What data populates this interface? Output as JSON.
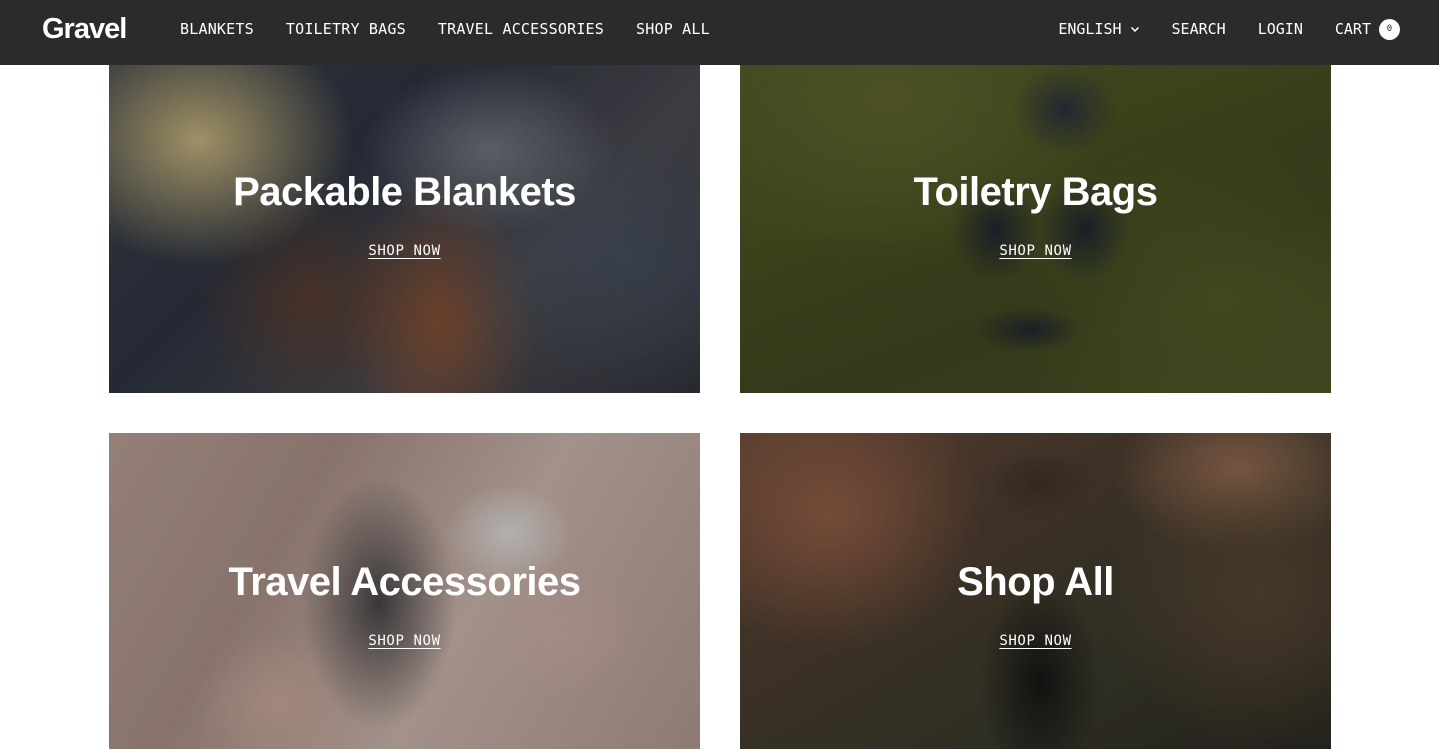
{
  "header": {
    "logo_text": "Gravel",
    "nav": [
      {
        "label": "BLANKETS"
      },
      {
        "label": "TOILETRY BAGS"
      },
      {
        "label": "TRAVEL ACCESSORIES"
      },
      {
        "label": "SHOP ALL"
      }
    ],
    "language": "ENGLISH",
    "search_label": "SEARCH",
    "login_label": "LOGIN",
    "cart_label": "CART",
    "cart_count": "0"
  },
  "tiles": [
    {
      "title": "Packable Blankets",
      "cta": "SHOP NOW"
    },
    {
      "title": "Toiletry Bags",
      "cta": "SHOP NOW"
    },
    {
      "title": "Travel Accessories",
      "cta": "SHOP NOW"
    },
    {
      "title": "Shop All",
      "cta": "SHOP NOW"
    }
  ],
  "colors": {
    "header_bg": "#2b2b2b",
    "text_on_dark": "#ffffff",
    "page_bg": "#ffffff"
  },
  "icons": {
    "language_dropdown": "chevron-down-icon"
  }
}
